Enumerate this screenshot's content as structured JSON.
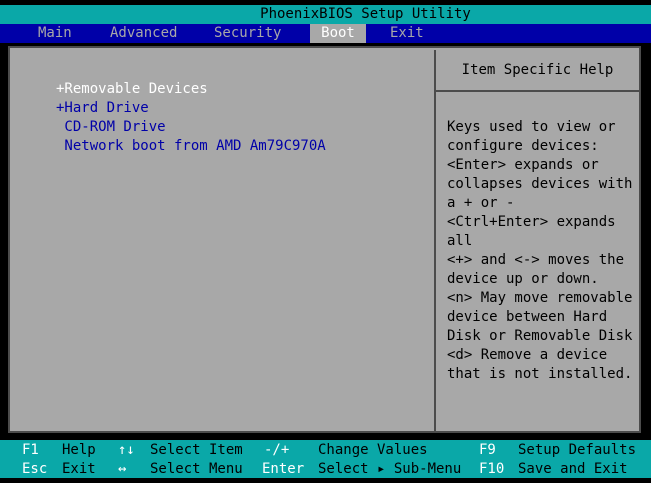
{
  "title": "PhoenixBIOS Setup Utility",
  "menu": {
    "tabs": [
      {
        "label": "Main",
        "active": false
      },
      {
        "label": "Advanced",
        "active": false
      },
      {
        "label": "Security",
        "active": false
      },
      {
        "label": "Boot",
        "active": true
      },
      {
        "label": "Exit",
        "active": false
      }
    ]
  },
  "boot_list": {
    "items": [
      {
        "label": "+Removable Devices",
        "selected": true
      },
      {
        "label": "+Hard Drive",
        "selected": false
      },
      {
        "label": " CD-ROM Drive",
        "selected": false
      },
      {
        "label": " Network boot from AMD Am79C970A",
        "selected": false
      }
    ]
  },
  "help": {
    "title": "Item Specific Help",
    "lines": [
      "Keys used to view or",
      "configure devices:",
      "<Enter> expands or",
      "collapses devices with",
      "a + or -",
      "<Ctrl+Enter> expands",
      "all",
      "<+> and <-> moves the",
      "device up or down.",
      "<n> May move removable",
      "device between Hard",
      "Disk or Removable Disk",
      "<d> Remove a device",
      "that is not installed."
    ]
  },
  "footer": {
    "row1": [
      {
        "key": "F1",
        "desc": "Help"
      },
      {
        "key": "↑↓",
        "desc": "Select Item"
      },
      {
        "key": "-/+",
        "desc": "Change Values"
      },
      {
        "key": "F9",
        "desc": "Setup Defaults"
      }
    ],
    "row2": [
      {
        "key": "Esc",
        "desc": "Exit"
      },
      {
        "key": "↔",
        "desc": "Select Menu"
      },
      {
        "key": "Enter",
        "desc": "Select ▸ Sub-Menu"
      },
      {
        "key": "F10",
        "desc": "Save and Exit"
      }
    ]
  },
  "colors": {
    "bios_blue": "#0000a8",
    "bios_gray": "#a8a8a8",
    "bios_cyan": "#0aa8a8"
  }
}
